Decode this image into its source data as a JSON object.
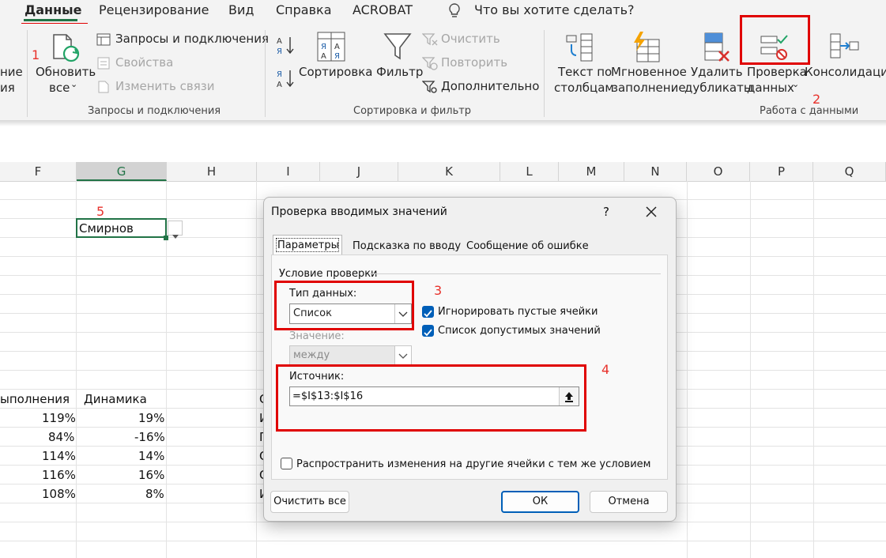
{
  "ribbon": {
    "tabs": [
      "Данные",
      "Рецензирование",
      "Вид",
      "Справка",
      "ACROBAT"
    ],
    "tell_me": "Что вы хотите сделать?",
    "partial_left": [
      "ние",
      "ия"
    ],
    "refresh_label1": "Обновить",
    "refresh_label2": "все",
    "queries": "Запросы и подключения",
    "properties": "Свойства",
    "edit_links": "Изменить связи",
    "group_queries": "Запросы и подключения",
    "sort": "Сортировка",
    "filter": "Фильтр",
    "clear": "Очистить",
    "reapply": "Повторить",
    "advanced": "Дополнительно",
    "group_sort": "Сортировка и фильтр",
    "text_to_columns1": "Текст по",
    "text_to_columns2": "столбцам",
    "flash_fill1": "Мгновенное",
    "flash_fill2": "заполнение",
    "remove_dup1": "Удалить",
    "remove_dup2": "дубликаты",
    "validation1": "Проверка",
    "validation2": "данных",
    "consolidate": "Консолидация",
    "group_data": "Работа с данными"
  },
  "annotations": [
    "1",
    "2",
    "3",
    "4",
    "5"
  ],
  "grid": {
    "columns": [
      "F",
      "G",
      "H",
      "I",
      "J",
      "K",
      "L",
      "M",
      "N",
      "O",
      "P",
      "Q"
    ],
    "g2_value": "Смирнов",
    "header_f": "ыполнения",
    "header_g": "Динамика",
    "col_f": [
      "119%",
      "84%",
      "114%",
      "116%",
      "108%"
    ],
    "col_g": [
      "19%",
      "-16%",
      "14%",
      "16%",
      "8%"
    ],
    "col_i_partial": [
      "С",
      "И",
      "П",
      "С",
      "С",
      "И"
    ]
  },
  "dialog": {
    "title": "Проверка вводимых значений",
    "help": "?",
    "tabs": [
      "Параметры",
      "Подсказка по вводу",
      "Сообщение об ошибке"
    ],
    "section": "Условие проверки",
    "type_label": "Тип данных:",
    "type_value": "Список",
    "ignore_blank": "Игнорировать пустые ячейки",
    "in_cell_dropdown": "Список допустимых значений",
    "value_label": "Значение:",
    "value_value": "между",
    "source_label": "Источник:",
    "source_value": "=$I$13:$I$16",
    "apply_all": "Распространить изменения на другие ячейки с тем же условием",
    "clear_all": "Очистить все",
    "ok": "ОК",
    "cancel": "Отмена"
  }
}
